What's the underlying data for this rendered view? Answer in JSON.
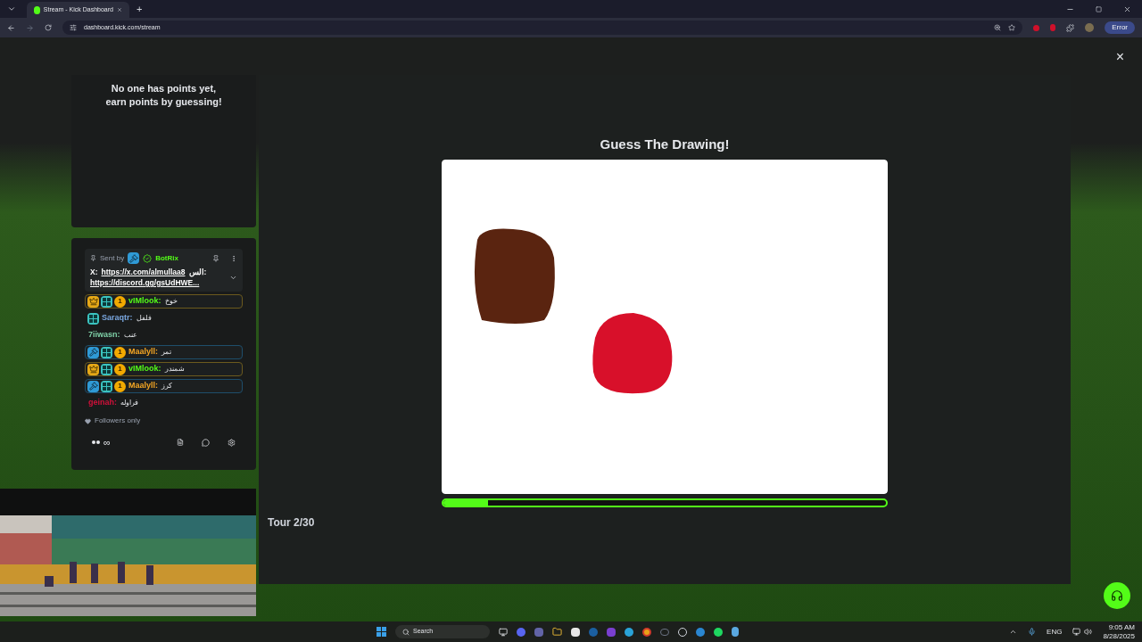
{
  "browser": {
    "tab_title": "Stream - Kick Dashboard",
    "new_tab": "+",
    "url": "dashboard.kick.com/stream",
    "profile_button": "Error"
  },
  "leaderboard": {
    "empty_text": "No one has points yet, earn points by guessing!"
  },
  "chat": {
    "pinned": {
      "sent_by": "Sent by",
      "bot": "BotRix",
      "prefix": "X:",
      "link1": "https://x.com/almullaa8",
      "suffix": "الس:",
      "link2": "https://discord.gg/gsUdHWE..."
    },
    "messages": [
      {
        "user": "vIMlook:",
        "text": "خوخ",
        "color": "#53fc18",
        "highlighted": true,
        "badges": [
          {
            "kind": "crown"
          },
          {
            "kind": "sub"
          },
          {
            "kind": "count",
            "text": "1"
          }
        ]
      },
      {
        "user": "Saraqtr:",
        "text": "فلفل",
        "color": "#7aa7e0",
        "highlighted": false,
        "badges": [
          {
            "kind": "sub"
          }
        ]
      },
      {
        "user": "7iiwasn:",
        "text": "عنب",
        "color": "#7fd1a8",
        "highlighted": false
      },
      {
        "user": "Maalyll:",
        "text": "تمر",
        "color": "#f5a623",
        "highlighted": true,
        "badges": [
          {
            "kind": "mod"
          },
          {
            "kind": "sub"
          },
          {
            "kind": "count",
            "text": "1"
          }
        ]
      },
      {
        "user": "vIMlook:",
        "text": "شمندر",
        "color": "#53fc18",
        "highlighted": true,
        "badges": [
          {
            "kind": "crown"
          },
          {
            "kind": "sub"
          },
          {
            "kind": "count",
            "text": "1"
          }
        ]
      },
      {
        "user": "Maalyll:",
        "text": "كرز",
        "color": "#f5a623",
        "highlighted": true,
        "badges": [
          {
            "kind": "mod"
          },
          {
            "kind": "sub"
          },
          {
            "kind": "count",
            "text": "1"
          }
        ]
      },
      {
        "user": "geinah:",
        "text": "فراوله",
        "color": "#d0103a",
        "highlighted": false
      }
    ],
    "mode": "Followers only",
    "infinity": "∞"
  },
  "game": {
    "title": "Guess The Drawing!",
    "progress": {
      "level": 0.1
    },
    "round": "Tour 2/30",
    "close": "×"
  },
  "taskbar": {
    "search": "Search",
    "language": "ENG",
    "time": "9:05 AM",
    "date": "8/28/2025"
  }
}
